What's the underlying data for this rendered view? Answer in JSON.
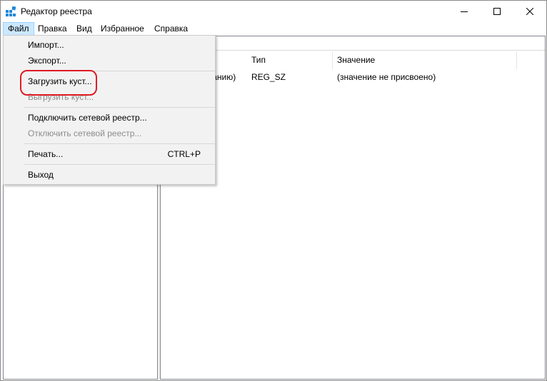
{
  "window": {
    "title": "Редактор реестра",
    "controls": {
      "minimize_icon": "minimize-icon",
      "maximize_icon": "maximize-icon",
      "close_icon": "close-icon"
    }
  },
  "menubar": {
    "items": [
      {
        "label": "Файл",
        "active": true
      },
      {
        "label": "Правка"
      },
      {
        "label": "Вид"
      },
      {
        "label": "Избранное"
      },
      {
        "label": "Справка"
      }
    ]
  },
  "file_menu": {
    "items": [
      {
        "label": "Импорт...",
        "enabled": true
      },
      {
        "label": "Экспорт...",
        "enabled": true
      },
      {
        "label": "Загрузить куст...",
        "enabled": true,
        "highlighted": true
      },
      {
        "label": "Выгрузить куст...",
        "enabled": false
      },
      {
        "label": "Подключить сетевой реестр...",
        "enabled": true
      },
      {
        "label": "Отключить сетевой реестр...",
        "enabled": false
      },
      {
        "label": "Печать...",
        "shortcut": "CTRL+P",
        "enabled": true
      },
      {
        "label": "Выход",
        "enabled": true
      }
    ]
  },
  "list": {
    "columns": [
      "Тип",
      "Значение"
    ],
    "rows": [
      {
        "name_partial": "чанию)",
        "type": "REG_SZ",
        "value": "(значение не присвоено)"
      }
    ]
  },
  "colors": {
    "menu_active_bg": "#cce8ff",
    "highlight_ring": "#e01a24",
    "disabled_text": "#8c8c8c"
  }
}
